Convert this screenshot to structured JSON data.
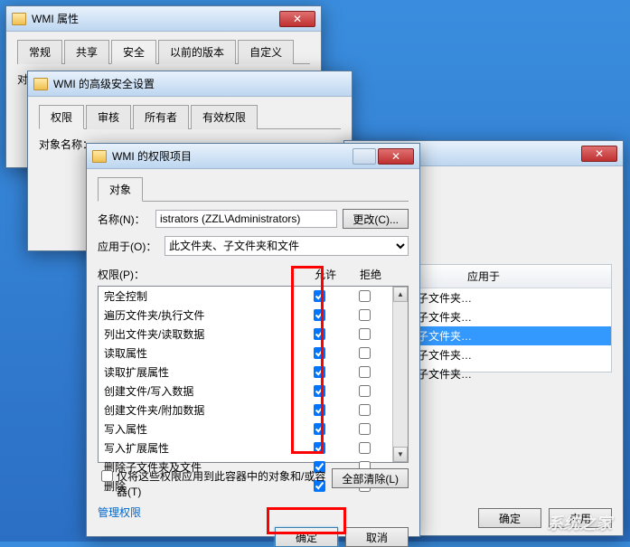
{
  "win1": {
    "title": "WMI 属性",
    "tabs": [
      "常规",
      "共享",
      "安全",
      "以前的版本",
      "自定义"
    ],
    "active_tab": 2,
    "object_label": "对象名称："
  },
  "win2": {
    "title": "WMI 的高级安全设置",
    "tabs": [
      "权限",
      "审核",
      "所有者",
      "有效权限"
    ],
    "active_tab": 0,
    "object_label": "对象名称："
  },
  "win3": {
    "applyto_header": "应用于",
    "rows": [
      "此文件夹、子文件夹…",
      "此文件夹、子文件夹…",
      "此文件夹、子文件夹…",
      "此文件夹、子文件夹…",
      "此文件夹、子文件夹…"
    ],
    "selected_index": 2,
    "ok": "确定",
    "apply": "应用"
  },
  "dlg": {
    "title": "WMI 的权限项目",
    "tab": "对象",
    "name_label": "名称(N)：",
    "name_value": "istrators (ZZL\\Administrators)",
    "change_btn": "更改(C)...",
    "applyto_label": "应用于(O)：",
    "applyto_value": "此文件夹、子文件夹和文件",
    "perm_label": "权限(P)：",
    "col_allow": "允许",
    "col_deny": "拒绝",
    "permissions": [
      {
        "name": "完全控制",
        "allow": true,
        "deny": false
      },
      {
        "name": "遍历文件夹/执行文件",
        "allow": true,
        "deny": false
      },
      {
        "name": "列出文件夹/读取数据",
        "allow": true,
        "deny": false
      },
      {
        "name": "读取属性",
        "allow": true,
        "deny": false
      },
      {
        "name": "读取扩展属性",
        "allow": true,
        "deny": false
      },
      {
        "name": "创建文件/写入数据",
        "allow": true,
        "deny": false
      },
      {
        "name": "创建文件夹/附加数据",
        "allow": true,
        "deny": false
      },
      {
        "name": "写入属性",
        "allow": true,
        "deny": false
      },
      {
        "name": "写入扩展属性",
        "allow": true,
        "deny": false
      },
      {
        "name": "删除子文件夹及文件",
        "allow": true,
        "deny": false
      },
      {
        "name": "删除",
        "allow": true,
        "deny": false
      }
    ],
    "only_apply_label": "仅将这些权限应用到此容器中的对象和/或容器(T)",
    "clear_all": "全部清除(L)",
    "manage_link": "管理权限",
    "ok": "确定",
    "cancel": "取消"
  }
}
